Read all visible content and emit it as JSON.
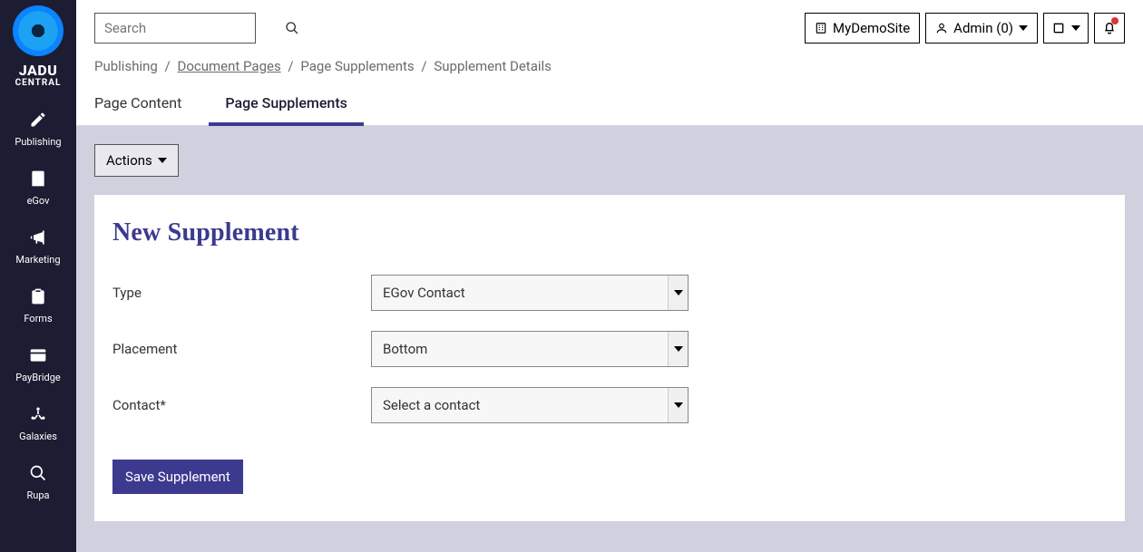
{
  "brand": {
    "name": "JADU",
    "sub": "CENTRAL"
  },
  "nav": [
    {
      "label": "Publishing"
    },
    {
      "label": "eGov"
    },
    {
      "label": "Marketing"
    },
    {
      "label": "Forms"
    },
    {
      "label": "PayBridge"
    },
    {
      "label": "Galaxies"
    },
    {
      "label": "Rupa"
    }
  ],
  "search": {
    "placeholder": "Search"
  },
  "topbar": {
    "site": "MyDemoSite",
    "user": "Admin (0)"
  },
  "breadcrumb": {
    "p0": "Publishing",
    "p1": "Document Pages",
    "p2": "Page Supplements",
    "p3": "Supplement Details"
  },
  "tabs": {
    "content": "Page Content",
    "supplements": "Page Supplements"
  },
  "actions": {
    "label": "Actions"
  },
  "form": {
    "heading": "New Supplement",
    "type_label": "Type",
    "type_value": "EGov Contact",
    "placement_label": "Placement",
    "placement_value": "Bottom",
    "contact_label": "Contact*",
    "contact_value": "Select a contact",
    "save": "Save Supplement"
  }
}
